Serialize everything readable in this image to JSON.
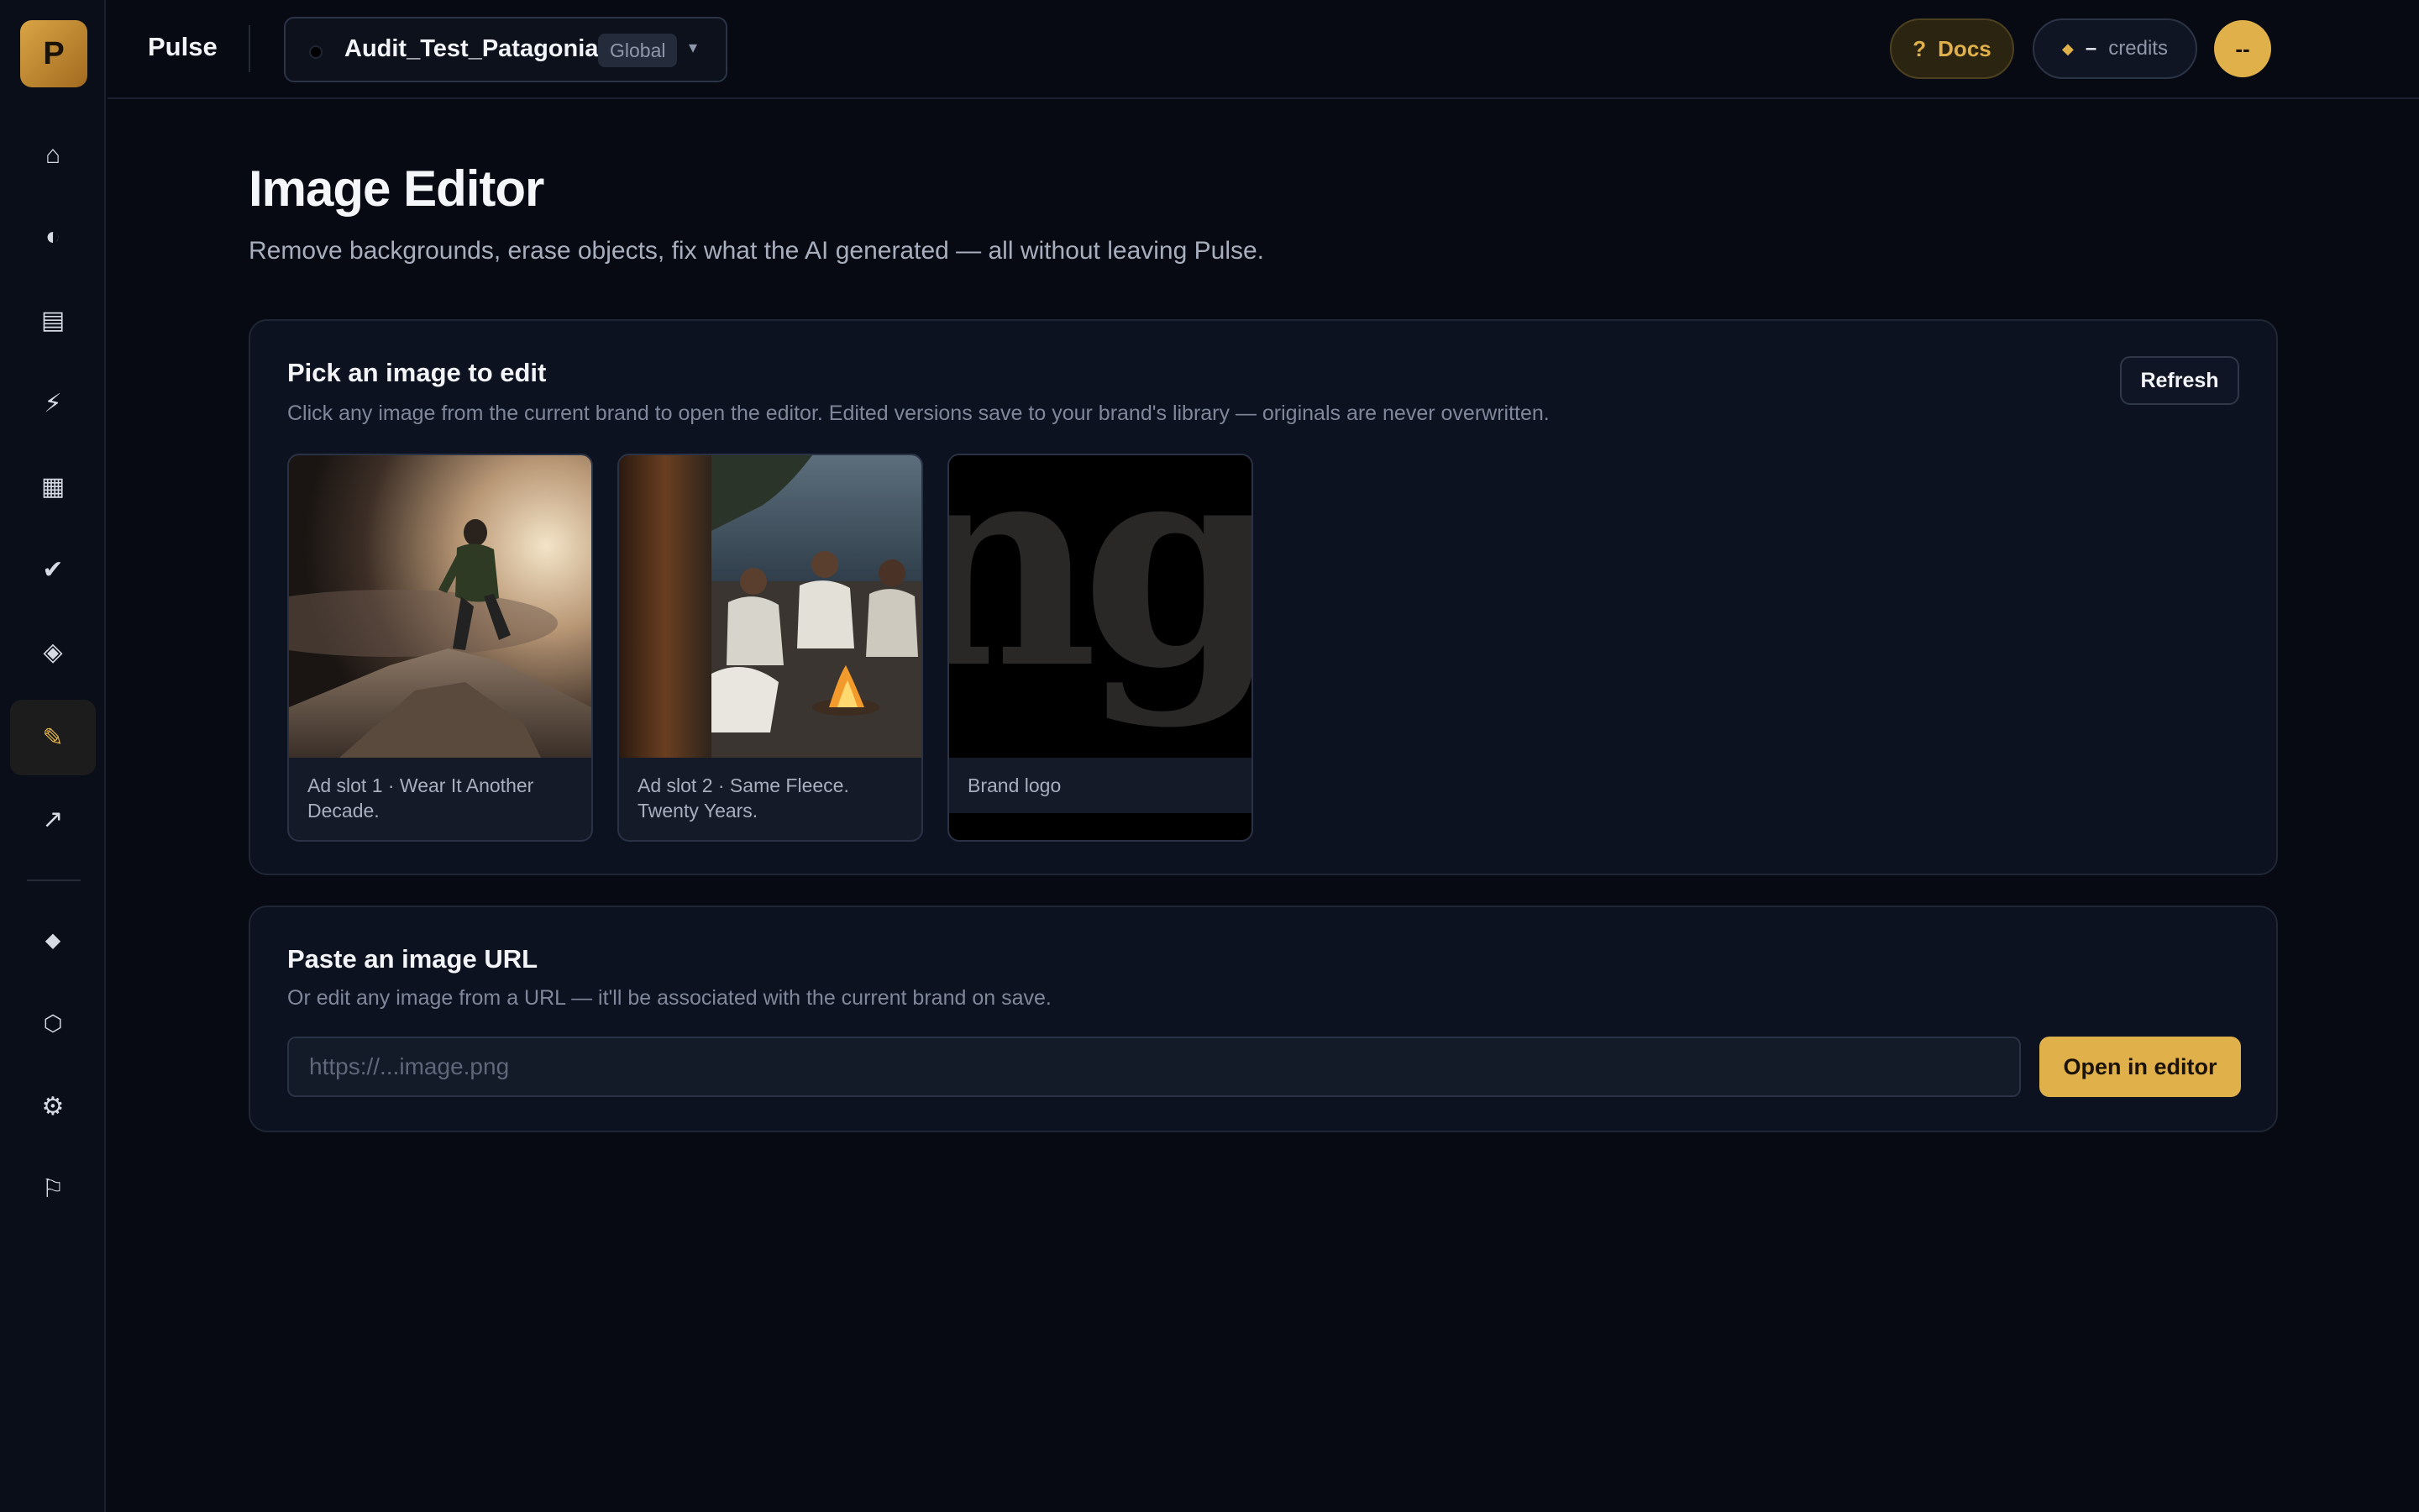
{
  "app": {
    "logo_letter": "P",
    "name": "Pulse"
  },
  "sidebar": {
    "items": [
      {
        "name": "home",
        "glyph": "⌂"
      },
      {
        "name": "analytics",
        "glyph": "◐"
      },
      {
        "name": "reports",
        "glyph": "▤"
      },
      {
        "name": "automations",
        "glyph": "⚡"
      },
      {
        "name": "calendar",
        "glyph": "▦"
      },
      {
        "name": "approvals",
        "glyph": "✔"
      },
      {
        "name": "assets",
        "glyph": "◈"
      },
      {
        "name": "image-editor",
        "glyph": "✎",
        "active": true
      },
      {
        "name": "trends",
        "glyph": "↗"
      },
      {
        "name": "credits",
        "glyph": "◆"
      },
      {
        "name": "integrations",
        "glyph": "⬡"
      },
      {
        "name": "settings",
        "glyph": "⚙"
      },
      {
        "name": "feedback",
        "glyph": "⚐"
      }
    ]
  },
  "header": {
    "brand": {
      "name": "Audit_Test_Patagonia",
      "badge": "Global",
      "caret": "▾"
    },
    "docs": {
      "icon": "?",
      "label": "Docs"
    },
    "credits": {
      "icon": "◆",
      "value": "–",
      "label": "credits"
    },
    "avatar": "--"
  },
  "main": {
    "title": "Image Editor",
    "subtitle": "Remove backgrounds, erase objects, fix what the AI generated — all without leaving Pulse."
  },
  "pick_card": {
    "title": "Pick an image to edit",
    "description": "Click any image from the current brand to open the editor. Edited versions save to your brand's library — originals are never overwritten.",
    "refresh_label": "Refresh",
    "images": [
      {
        "caption": "Ad slot 1 · Wear It Another Decade."
      },
      {
        "caption": "Ad slot 2 · Same Fleece. Twenty Years."
      },
      {
        "caption": "Brand logo",
        "logo_text": "ngo"
      }
    ]
  },
  "url_card": {
    "title": "Paste an image URL",
    "description": "Or edit any image from a URL — it'll be associated with the current brand on save.",
    "input_value": "",
    "input_placeholder": "https://...image.png",
    "open_label": "Open in editor"
  },
  "colors": {
    "accent": "#e0b04a",
    "background": "#070a12",
    "card": "#0d1220"
  }
}
